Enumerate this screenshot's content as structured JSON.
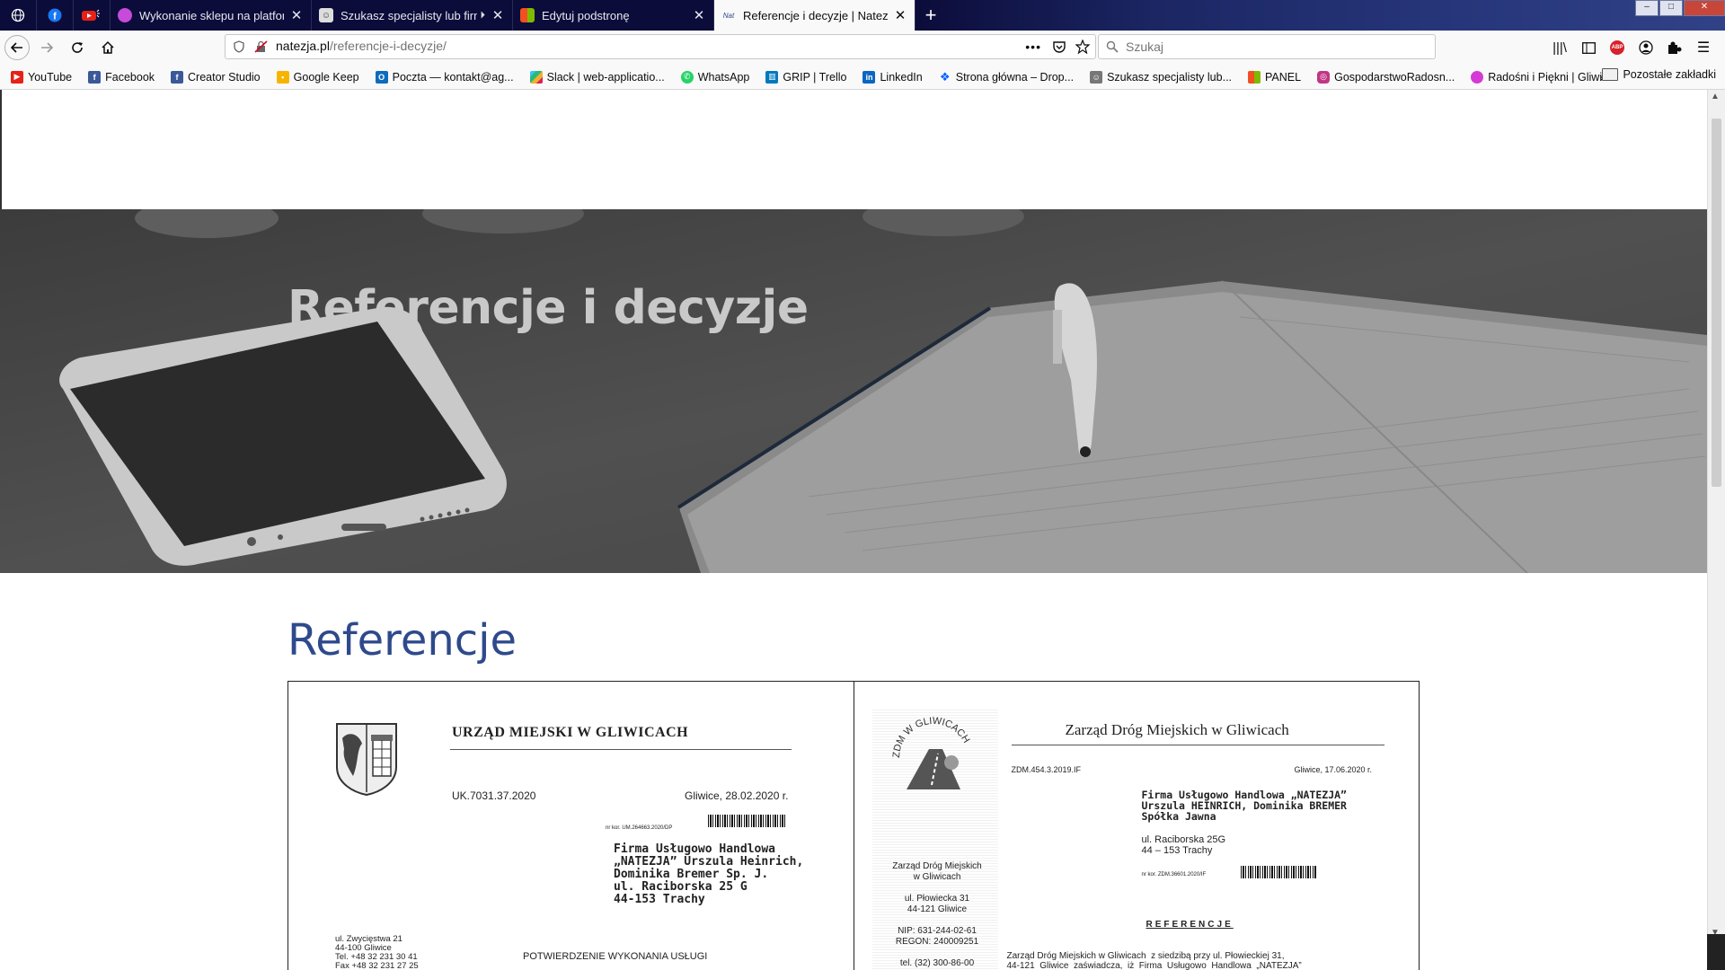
{
  "window_controls": [
    "–",
    "□",
    "✕"
  ],
  "tabs": [
    {
      "title": "Wykonanie sklepu na platformie",
      "icon": "purple-circle-icon"
    },
    {
      "title": "Szukasz specjalisty lub firmy",
      "icon": "site-favicon"
    },
    {
      "title": "Edytuj podstronę",
      "icon": "windows-logo-icon"
    },
    {
      "title": "Referencje i decyzje | Natezja",
      "icon": "natezja-favicon",
      "active": true
    }
  ],
  "navbar": {
    "url_domain": "natezja.pl",
    "url_path": "/referencje-i-decyzje/",
    "page_actions_label": "•••",
    "search_placeholder": "Szukaj"
  },
  "bookmarks": [
    {
      "label": "YouTube",
      "color": "#e62117"
    },
    {
      "label": "Facebook",
      "color": "#3b5998"
    },
    {
      "label": "Creator Studio",
      "color": "#3b5998"
    },
    {
      "label": "Google Keep",
      "color": "#f6b400"
    },
    {
      "label": "Poczta — kontakt@ag...",
      "color": "#0f6cbd"
    },
    {
      "label": "Slack | web-applicatio...",
      "color": "#611f69"
    },
    {
      "label": "WhatsApp",
      "color": "#25d366"
    },
    {
      "label": "GRIP | Trello",
      "color": "#0079bf"
    },
    {
      "label": "LinkedIn",
      "color": "#0a66c2"
    },
    {
      "label": "Strona główna – Drop...",
      "color": "#0061ff"
    },
    {
      "label": "Szukasz specjalisty lub...",
      "color": "#555555"
    },
    {
      "label": "PANEL",
      "color": "#f25022"
    },
    {
      "label": "GospodarstwoRadosn...",
      "color": "#c13584"
    },
    {
      "label": "Radośni i Piękni | Gliwi...",
      "color": "#d63ad6"
    }
  ],
  "bookmarks_other": "Pozostałe zakładki",
  "page": {
    "hero_title": "Referencje i decyzje",
    "section_title": "Referencje"
  },
  "doc1": {
    "org": "URZĄD MIEJSKI W GLIWICACH",
    "ref": "UK.7031.37.2020",
    "date": "Gliwice, 28.02.2020 r.",
    "small_ref": "nr kor. UM.264663.2020/DP",
    "address": "Firma Usługowo Handlowa\n„NATEZJA” Urszula Heinrich,\nDominika Bremer Sp. J.\nul. Raciborska 25 G\n44-153 Trachy",
    "side": "ul. Zwycięstwa 21\n44-100 Gliwice\nTel. +48 32 231 30 41\nFax +48 32 231 27 25",
    "confirm": "POTWIERDZENIE WYKONANIA USŁUGI"
  },
  "doc2": {
    "org": "Zarząd Dróg Miejskich w Gliwicach",
    "logo_text": "ZDM W GLIWICACH",
    "ref": "ZDM.454.3.2019.IF",
    "date": "Gliwice, 17.06.2020 r.",
    "address": "Firma Usługowo Handlowa „NATEZJA”\nUrszula HEINRICH, Dominika BREMER\nSpółka Jawna",
    "plain": "ul. Raciborska 25G\n44 – 153 Trachy",
    "small_ref": "nr kor. ZDM.36601.2020/IF",
    "side": "Zarząd Dróg Miejskich\nw Gliwicach\n\nul. Płowiecka 31\n44-121 Gliwice\n\nNIP: 631-244-02-61\nREGON: 240009251\n\ntel. (32) 300-86-00",
    "ref_heading": "REFERENCJE",
    "body": "Zarząd Dróg Miejskich w Gliwicach  z siedzibą przy ul. Płowieckiej 31,\n44-121  Gliwice  zaświadcza,  iż  Firma  Usługowo  Handlowa  „NATEZJA”"
  }
}
